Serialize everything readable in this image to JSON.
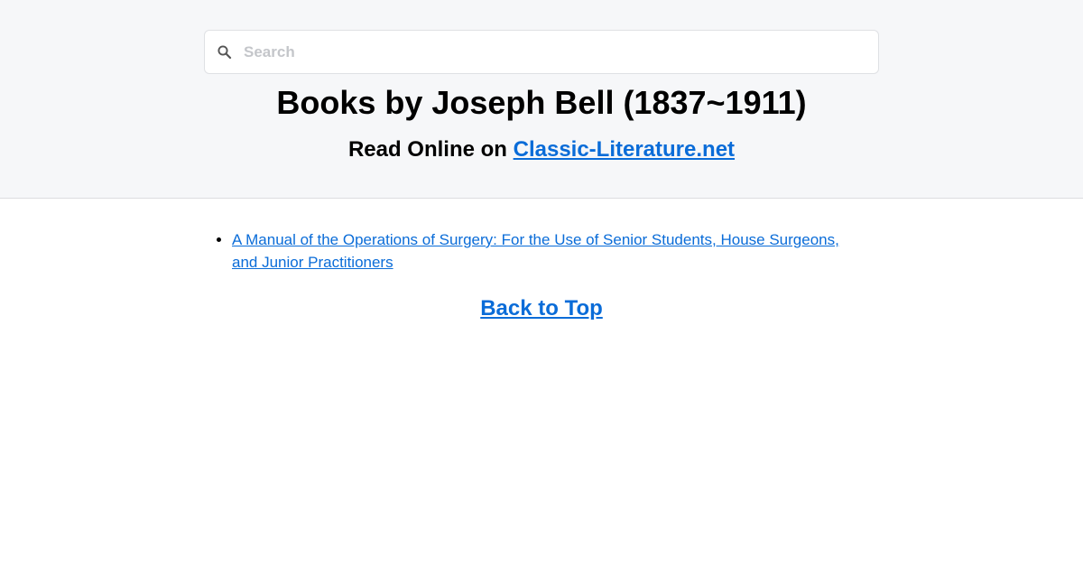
{
  "search": {
    "placeholder": "Search",
    "icon": "search-icon"
  },
  "header": {
    "title": "Books by Joseph Bell (1837~1911)",
    "subtitle_prefix": "Read Online on",
    "site_link": "Classic-Literature.net"
  },
  "books": [
    {
      "title": "A Manual of the Operations of Surgery: For the Use of Senior Students, House Surgeons, and Junior Practitioners"
    }
  ],
  "footer": {
    "back_to_top": "Back to Top"
  },
  "colors": {
    "link": "#0a6cd8",
    "header_bg": "#f6f7f9"
  }
}
